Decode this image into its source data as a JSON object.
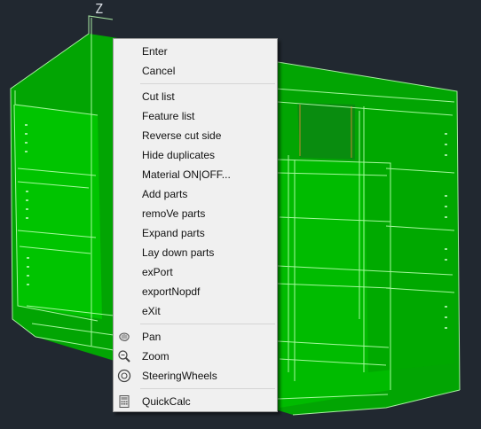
{
  "viewport": {
    "axis_label": "Z",
    "background_color": "#212830",
    "model_color": "#00c000",
    "wire_color": "#b9ffb0"
  },
  "menu": {
    "group1": [
      {
        "label": "Enter"
      },
      {
        "label": "Cancel"
      }
    ],
    "group2": [
      {
        "label": "Cut list"
      },
      {
        "label": "Feature list"
      },
      {
        "label": "Reverse cut side"
      },
      {
        "label": "Hide duplicates"
      },
      {
        "label": "Material ON|OFF..."
      },
      {
        "label": "Add parts"
      },
      {
        "label": "remoVe parts"
      },
      {
        "label": "Expand parts"
      },
      {
        "label": "Lay down parts"
      },
      {
        "label": "exPort"
      },
      {
        "label": "exportNopdf"
      },
      {
        "label": "eXit"
      }
    ],
    "group3": [
      {
        "label": "Pan",
        "icon": "pan-hand-icon"
      },
      {
        "label": "Zoom",
        "icon": "zoom-magnifier-icon"
      },
      {
        "label": "SteeringWheels",
        "icon": "steering-wheel-icon"
      }
    ],
    "group4": [
      {
        "label": "QuickCalc",
        "icon": "calculator-icon"
      }
    ]
  }
}
